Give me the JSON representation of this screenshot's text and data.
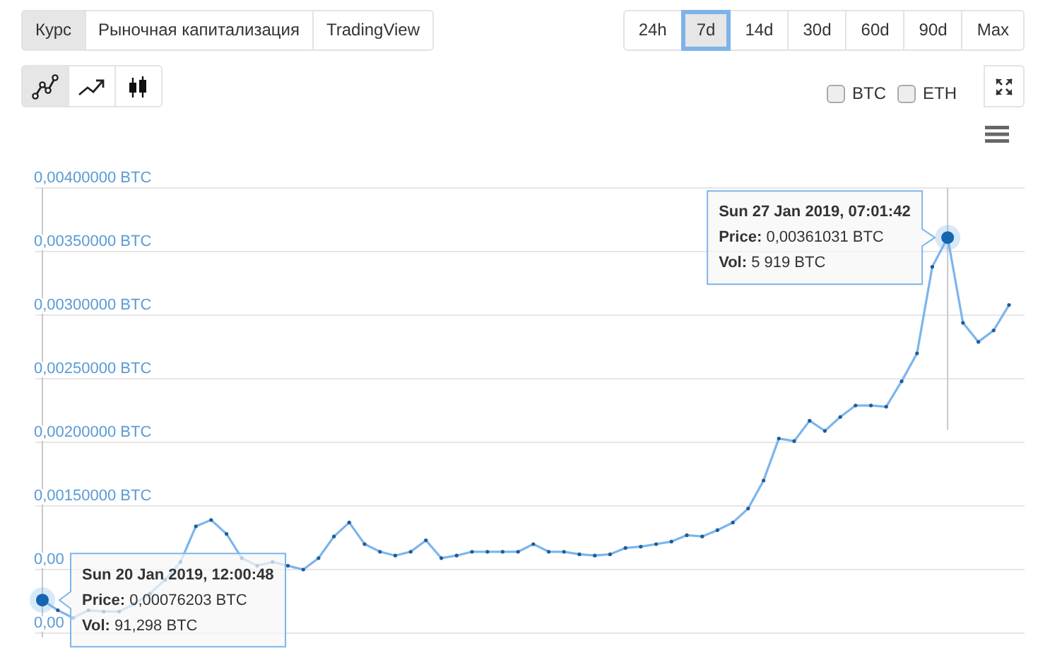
{
  "view_tabs": [
    {
      "label": "Курс",
      "selected": true
    },
    {
      "label": "Рыночная капитализация",
      "selected": false
    },
    {
      "label": "TradingView",
      "selected": false
    }
  ],
  "periods": [
    {
      "label": "24h",
      "selected": false
    },
    {
      "label": "7d",
      "selected": true
    },
    {
      "label": "14d",
      "selected": false
    },
    {
      "label": "30d",
      "selected": false
    },
    {
      "label": "60d",
      "selected": false
    },
    {
      "label": "90d",
      "selected": false
    },
    {
      "label": "Max",
      "selected": false
    }
  ],
  "chart_types": [
    {
      "kind": "markers",
      "selected": true
    },
    {
      "kind": "trend",
      "selected": false
    },
    {
      "kind": "candles",
      "selected": false
    }
  ],
  "compare": [
    {
      "label": "BTC",
      "checked": false
    },
    {
      "label": "ETH",
      "checked": false
    }
  ],
  "chart": {
    "chart_data": {
      "type": "line",
      "categories": [
        null,
        null,
        null,
        null,
        null,
        null,
        null,
        null,
        null,
        null,
        null,
        null,
        null,
        null,
        null,
        null,
        null,
        null,
        null,
        null,
        null,
        null,
        null,
        null,
        null,
        null,
        null,
        null,
        null,
        null,
        null,
        null,
        null,
        null,
        null,
        null,
        null,
        null,
        null,
        null,
        null,
        null,
        null,
        null,
        null,
        null,
        null,
        null,
        null,
        null,
        null,
        null,
        null,
        null,
        null,
        null,
        null,
        null,
        null,
        null,
        null,
        null,
        null,
        null
      ],
      "grid": true,
      "series": [
        {
          "color": "#7cb5ec",
          "values": [
            0.00076,
            0.00068,
            0.00062,
            0.00068,
            0.00067,
            0.00067,
            0.00073,
            0.00081,
            0.00092,
            0.00106,
            0.00134,
            0.00139,
            0.00128,
            0.00109,
            0.00103,
            0.00106,
            0.00103,
            0.001,
            0.00109,
            0.00126,
            0.00137,
            0.0012,
            0.00114,
            0.00111,
            0.00114,
            0.00123,
            0.00109,
            0.00111,
            0.00114,
            0.00114,
            0.00114,
            0.00114,
            0.0012,
            0.00114,
            0.00114,
            0.00112,
            0.00111,
            0.00112,
            0.00117,
            0.00118,
            0.0012,
            0.00122,
            0.00127,
            0.00126,
            0.00131,
            0.00137,
            0.00148,
            0.0017,
            0.00203,
            0.00201,
            0.00217,
            0.00209,
            0.0022,
            0.00229,
            0.00229,
            0.00228,
            0.00248,
            0.0027,
            0.00338,
            0.00361,
            0.00294,
            0.00279,
            0.00288,
            0.00308
          ]
        }
      ],
      "ylim": [
        0.0005,
        0.004
      ],
      "yticks": [
        {
          "value": 0.004,
          "label": "0,00400000 BTC"
        },
        {
          "value": 0.0035,
          "label": "0,00350000 BTC"
        },
        {
          "value": 0.003,
          "label": "0,00300000 BTC"
        },
        {
          "value": 0.0025,
          "label": "0,00250000 BTC"
        },
        {
          "value": 0.002,
          "label": "0,00200000 BTC"
        },
        {
          "value": 0.0015,
          "label": "0,00150000 BTC"
        }
      ]
    },
    "covered_tick_labels": [
      "0,00",
      "0,00"
    ],
    "tooltips": [
      {
        "kind": "peak",
        "title": "Sun 27 Jan 2019, 07:01:42",
        "lines": [
          "**Price:** 0,00361031 BTC",
          "**Vol:** 5 919 BTC"
        ]
      },
      {
        "kind": "start",
        "title": "Sun 20 Jan 2019, 12:00:48",
        "lines": [
          "**Price:** 0,00076203 BTC",
          "**Vol:** 91,298 BTC"
        ]
      }
    ]
  }
}
